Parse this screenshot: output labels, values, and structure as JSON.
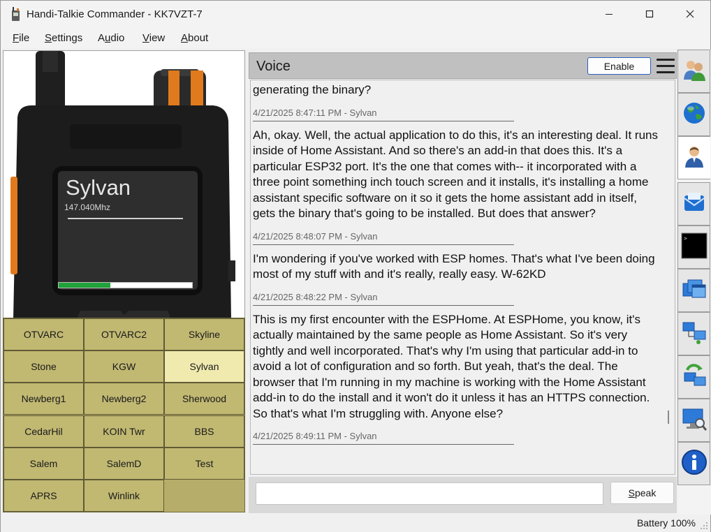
{
  "window": {
    "title": "Handi-Talkie Commander - KK7VZT-7"
  },
  "menu": {
    "file_pre": "",
    "file_ul": "F",
    "file_post": "ile",
    "settings_pre": "",
    "settings_ul": "S",
    "settings_post": "ettings",
    "audio_pre": "A",
    "audio_ul": "u",
    "audio_post": "dio",
    "view_pre": "",
    "view_ul": "V",
    "view_post": "iew",
    "about_pre": "",
    "about_ul": "A",
    "about_post": "bout"
  },
  "radio": {
    "channel_name": "Sylvan",
    "frequency": "147.040Mhz",
    "signal_level": 0.39,
    "signal_color": "#1fa33a"
  },
  "channels": [
    {
      "label": "OTVARC",
      "active": false
    },
    {
      "label": "OTVARC2",
      "active": false
    },
    {
      "label": "Skyline",
      "active": false
    },
    {
      "label": "Stone",
      "active": false
    },
    {
      "label": "KGW",
      "active": false
    },
    {
      "label": "Sylvan",
      "active": true
    },
    {
      "label": "Newberg1",
      "active": false
    },
    {
      "label": "Newberg2",
      "active": false
    },
    {
      "label": "Sherwood",
      "active": false
    },
    {
      "label": "CedarHil",
      "active": false
    },
    {
      "label": "KOIN Twr",
      "active": false
    },
    {
      "label": "BBS",
      "active": false
    },
    {
      "label": "Salem",
      "active": false
    },
    {
      "label": "SalemD",
      "active": false
    },
    {
      "label": "Test",
      "active": false
    },
    {
      "label": "APRS",
      "active": false
    },
    {
      "label": "Winlink",
      "active": false
    }
  ],
  "voice": {
    "title": "Voice",
    "enable_label": "Enable",
    "speak_pre": "",
    "speak_ul": "S",
    "speak_post": "peak",
    "input_value": "",
    "messages": [
      {
        "text": "generating the binary?",
        "meta": "4/21/2025 8:47:11 PM - Sylvan"
      },
      {
        "text": "Ah, okay. Well, the actual application to do this, it's an interesting deal. It runs inside of Home Assistant. And so there's an add-in that does this. It's a particular ESP32 port. It's the one that comes with-- it incorporated with a three point something inch touch screen and it installs, it's installing a home assistant specific software on it so it gets the home assistant add in itself, gets the binary that's going to be installed. But does that answer?",
        "meta": "4/21/2025 8:48:07 PM - Sylvan"
      },
      {
        "text": "I'm wondering if you've worked with ESP homes. That's what I've been doing most of my stuff with and it's really, really easy. W-62KD",
        "meta": "4/21/2025 8:48:22 PM - Sylvan"
      },
      {
        "text": "This is my first encounter with the ESPHome. At ESPHome, you know, it's actually maintained by the same people as Home Assistant. So it's very tightly and well incorporated. That's why I'm using that particular add-in to avoid a lot of configuration and so forth. But yeah, that's the deal. The browser that I'm running in my machine is working with the Home Assistant add-in to do the install and it won't do it unless it has an HTTPS connection. So that's what I'm struggling with. Anyone else?",
        "meta": "4/21/2025 8:49:11 PM - Sylvan"
      }
    ]
  },
  "sidebar": {
    "tabs": [
      {
        "icon": "contacts-icon",
        "active": false
      },
      {
        "icon": "globe-icon",
        "active": false
      },
      {
        "icon": "user-icon",
        "active": true
      },
      {
        "icon": "mail-icon",
        "active": false
      },
      {
        "icon": "terminal-icon",
        "active": false
      },
      {
        "icon": "windows-icon",
        "active": false
      },
      {
        "icon": "network-icon",
        "active": false
      },
      {
        "icon": "sync-icon",
        "active": false
      },
      {
        "icon": "search-computer-icon",
        "active": false
      },
      {
        "icon": "info-icon",
        "active": false
      }
    ]
  },
  "status": {
    "battery": "Battery 100%"
  }
}
